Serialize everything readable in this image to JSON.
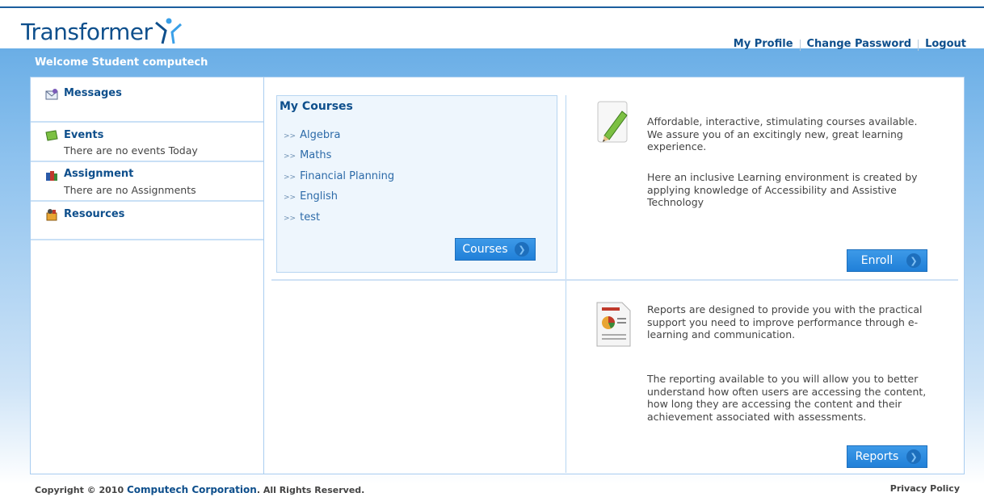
{
  "header": {
    "logo_text": "Transformer",
    "links": [
      "My Profile",
      "Change Password",
      "Logout"
    ]
  },
  "welcome": "Welcome Student computech",
  "sidebar": {
    "items": [
      {
        "label": "Messages",
        "icon": "envelope-icon"
      },
      {
        "label": "Events",
        "sub": "There are no events Today",
        "icon": "events-icon"
      },
      {
        "label": "Assignment",
        "sub": "There are no Assignments",
        "icon": "books-icon"
      },
      {
        "label": "Resources",
        "icon": "resources-icon"
      }
    ]
  },
  "courses": {
    "title": "My Courses",
    "items": [
      "Algebra",
      "Maths",
      "Financial Planning",
      "English",
      "test"
    ],
    "button": "Courses"
  },
  "enroll": {
    "text1": "Affordable, interactive, stimulating courses available. We assure you of an excitingly new, great learning experience.",
    "text2": "Here an inclusive Learning environment is created by applying knowledge of Accessibility and Assistive Technology",
    "button": "Enroll"
  },
  "reports": {
    "text1": "Reports are designed to provide you with the practical support you need to improve performance through e-learning and communication.",
    "text2": "The reporting available to you will allow you to better understand how often users are accessing the content, how long they are accessing the content and their achievement associated with assessments.",
    "button": "Reports"
  },
  "footer": {
    "copyright_prefix": "Copyright © 2010",
    "company": "Computech Corporation",
    "copyright_suffix": ". All Rights Reserved.",
    "privacy": "Privacy Policy"
  },
  "colors": {
    "brand": "#0e4f8c",
    "accent": "#2080d8",
    "banner": "#6aaee6"
  }
}
